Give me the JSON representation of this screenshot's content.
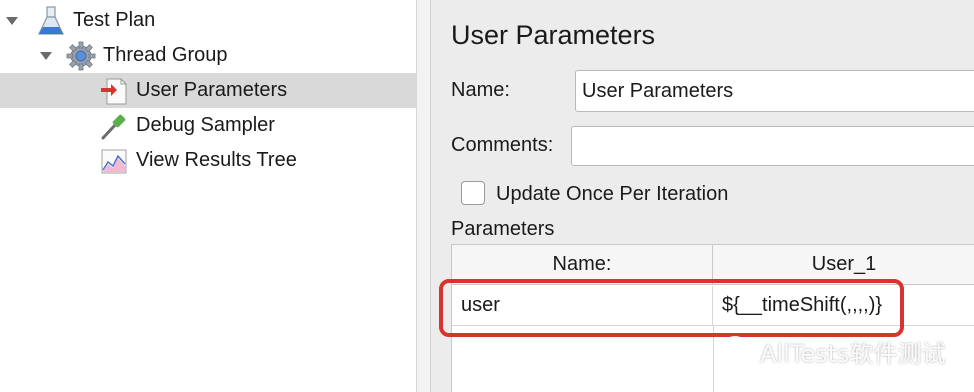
{
  "tree": {
    "items": [
      {
        "label": "Test Plan",
        "icon": "flask-icon",
        "expanded": true
      },
      {
        "label": "Thread Group",
        "icon": "gear-icon",
        "expanded": true
      },
      {
        "label": "User Parameters",
        "icon": "user-parameters-icon",
        "selected": true
      },
      {
        "label": "Debug Sampler",
        "icon": "dropper-icon"
      },
      {
        "label": "View Results Tree",
        "icon": "results-graph-icon"
      }
    ]
  },
  "editor": {
    "title": "User Parameters",
    "name_label": "Name:",
    "name_value": "User Parameters",
    "comments_label": "Comments:",
    "comments_value": "",
    "update_once_label": "Update Once Per Iteration",
    "update_once_checked": false,
    "parameters_label": "Parameters"
  },
  "table": {
    "headers": [
      "Name:",
      "User_1"
    ],
    "rows": [
      [
        "user",
        "${__timeShift(,,,,)}"
      ]
    ]
  },
  "watermark": {
    "text": "AllTests软件测试",
    "icon": "wechat-icon"
  },
  "colors": {
    "selection": "#d9d9d9",
    "highlight_border": "#d9342b"
  }
}
